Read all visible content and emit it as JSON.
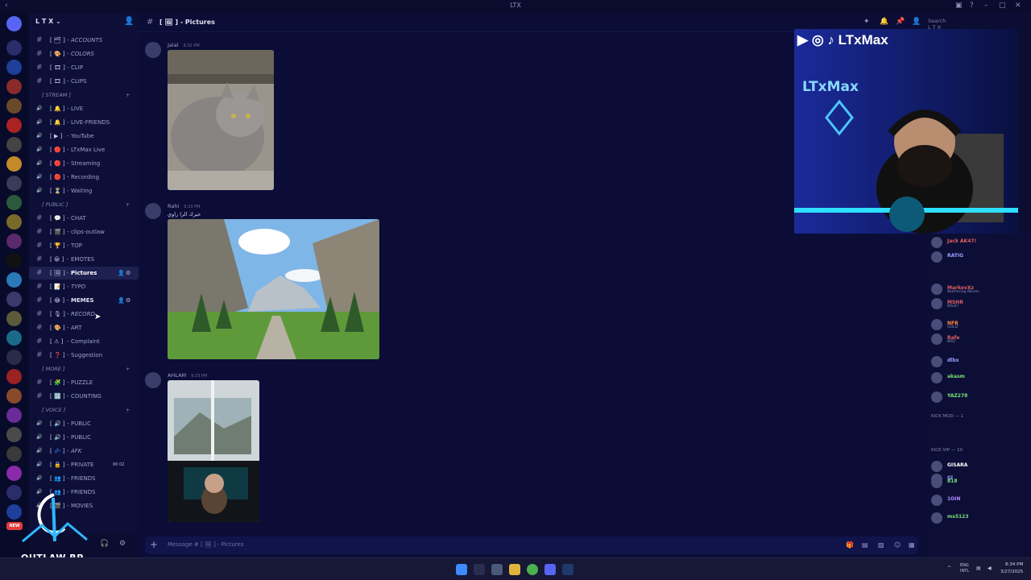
{
  "window": {
    "title": "LTX"
  },
  "guild": {
    "name": "L T X"
  },
  "channels": [
    {
      "emoji": "[ 🗂 ]",
      "name": "ACCOUNTS",
      "italic": true
    },
    {
      "emoji": "[ 🎨 ]",
      "name": "COLORS",
      "italic": true
    },
    {
      "emoji": "[ 🎞 ]",
      "name": "CLIP"
    },
    {
      "emoji": "[ 🎞 ]",
      "name": "CLIPS"
    },
    {
      "category": "[ STREAM ]"
    },
    {
      "emoji": "[ 🔔 ]",
      "name": "LIVE",
      "voice": true
    },
    {
      "emoji": "[ 🔔 ]",
      "name": "LIVE-FRIENDS",
      "voice": true
    },
    {
      "emoji": "[ ▶ ]",
      "name": "YouTube",
      "voice": true
    },
    {
      "emoji": "[ 🔴 ]",
      "name": "LTxMax Live",
      "voice": true
    },
    {
      "emoji": "[ 🔴 ]",
      "name": "Streaming",
      "voice": true
    },
    {
      "emoji": "[ 🔴 ]",
      "name": "Recording",
      "voice": true
    },
    {
      "emoji": "[ ⏳ ]",
      "name": "Waiting",
      "voice": true
    },
    {
      "category": "[ PUBLIC ]"
    },
    {
      "emoji": "[ 💬 ]",
      "name": "CHAT"
    },
    {
      "emoji": "[ 🎬 ]",
      "name": "clips-outlaw"
    },
    {
      "emoji": "[ 🏆 ]",
      "name": "TOP"
    },
    {
      "emoji": "[ 😀 ]",
      "name": "EMOTES"
    },
    {
      "emoji": "[ 🖼 ]",
      "name": "Pictures",
      "active": true
    },
    {
      "emoji": "[ 📝 ]",
      "name": "TYPO",
      "italic": true
    },
    {
      "emoji": "[ 😂 ]",
      "name": "MEMES",
      "bold": true
    },
    {
      "emoji": "[ 🎙 ]",
      "name": "RECORD",
      "italic": true
    },
    {
      "emoji": "[ 🎨 ]",
      "name": "ART"
    },
    {
      "emoji": "[ ⚠ ]",
      "name": "Complaint"
    },
    {
      "emoji": "[ ❓ ]",
      "name": "Suggestion"
    },
    {
      "category": "[ MORE ]"
    },
    {
      "emoji": "[ 🧩 ]",
      "name": "PUZZLE"
    },
    {
      "emoji": "[ 🔢 ]",
      "name": "COUNTING"
    },
    {
      "category": "[ VOICE ]"
    },
    {
      "emoji": "[ 🔊 ]",
      "name": "PUBLIC",
      "voice": true
    },
    {
      "emoji": "[ 🔊 ]",
      "name": "PUBLIC",
      "voice": true
    },
    {
      "emoji": "[ 💤 ]",
      "name": "AFK",
      "voice": true,
      "italic": true
    },
    {
      "emoji": "[ 🔒 ]",
      "name": "PRIVATE",
      "voice": true,
      "count": "00 02"
    },
    {
      "emoji": "[ 👥 ]",
      "name": "FRIENDS",
      "voice": true
    },
    {
      "emoji": "[ 👥 ]",
      "name": "FRIENDS",
      "voice": true
    },
    {
      "emoji": "[ 🎬 ]",
      "name": "MOVIES",
      "voice": true
    }
  ],
  "chat": {
    "channel_title": "[ 🖼 ] - Pictures",
    "search_placeholder": "Search L T X",
    "composer_placeholder": "Message # [ 🖼 ] - Pictures",
    "messages": [
      {
        "author": "Jalal",
        "time": "9:32 PM"
      },
      {
        "author": "Rahi",
        "time": "9:33 PM",
        "reply": "خيرك الرا راوي"
      },
      {
        "author": "AHLAM",
        "time": "9:33 PM"
      }
    ]
  },
  "stream": {
    "channel_name": "LTxMax",
    "neon_sign": "LTxMax"
  },
  "members": {
    "sections": [
      "KICK MOD — 1",
      "KICK VIP — 10"
    ],
    "items": [
      {
        "name": "Jack AK47!"
      },
      {
        "name": "RATIG"
      },
      {
        "name": "MarkovXz",
        "sub": "Wuthering Waves"
      },
      {
        "name": "MSHR",
        "sub": "What?"
      },
      {
        "name": "NFR",
        "sub": "GOLD"
      },
      {
        "name": "Rafe",
        "sub": "BRQ"
      },
      {
        "name": "dlbx"
      },
      {
        "name": "akasm"
      },
      {
        "name": "YAZ278"
      },
      {
        "name": "Gl"
      },
      {
        "name": "GISARA"
      },
      {
        "name": "818"
      },
      {
        "name": "1OIN"
      },
      {
        "name": "ms5123"
      }
    ]
  },
  "branding": {
    "overlay_logo": "OUTLAW RP",
    "new_badge": "NEW"
  },
  "taskbar": {
    "lang": "ENG",
    "lang2": "INTL",
    "time": "8:34 PM",
    "date": "3/27/2025"
  },
  "colors": {
    "background": "#0b0d33",
    "accent": "#5865f2",
    "danger": "#e23b3b"
  }
}
